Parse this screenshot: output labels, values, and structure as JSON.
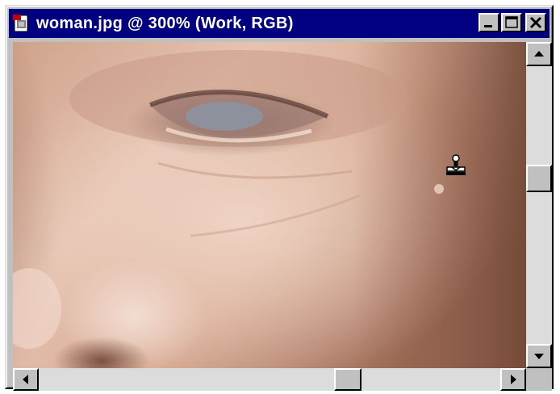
{
  "window": {
    "title": "woman.jpg @ 300%  (Work, RGB)"
  },
  "icons": {
    "document": "photoshop-document-icon",
    "minimize": "minimize-icon",
    "maximize": "maximize-icon",
    "close": "close-icon",
    "cursor": "rubber-stamp-cursor-icon"
  },
  "colors": {
    "titlebar": "#000080",
    "chrome": "#c0c0c0",
    "scroll_track": "#dcdcdc"
  },
  "scrollbars": {
    "vertical_position": 0.42,
    "horizontal_position": 0.63
  }
}
